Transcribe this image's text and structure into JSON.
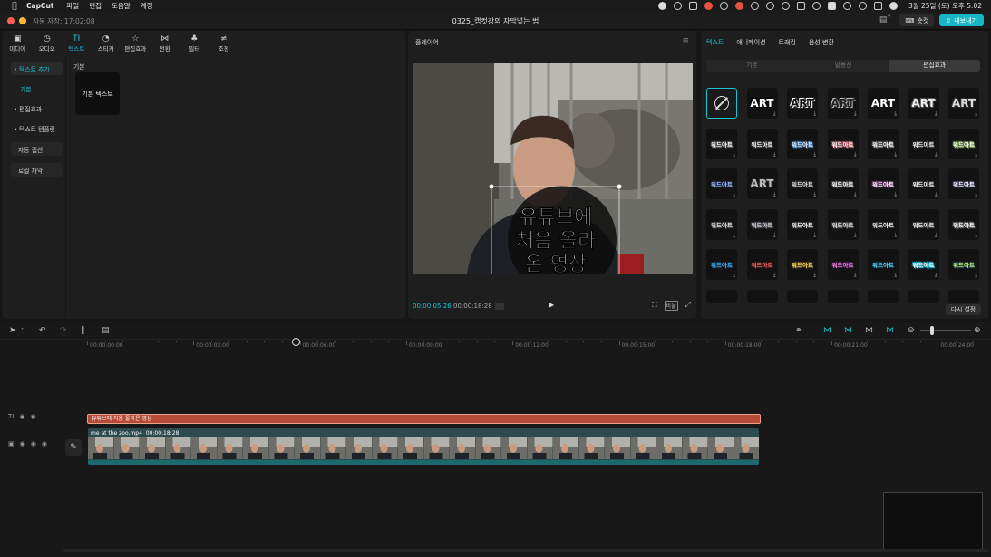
{
  "menubar": {
    "app": "CapCut",
    "menus": [
      "파일",
      "편집",
      "도움말",
      "계정"
    ],
    "clock": "3월 25일 (토) 오후 5:02"
  },
  "titlebar": {
    "autosave": "자동 저장: 17:02:08",
    "title": "0325_캡컷강의 자막넣는 법",
    "shortcut": "숏컷",
    "export": "내보내기"
  },
  "tools": [
    {
      "label": "미디어",
      "icon": "media-icon"
    },
    {
      "label": "오디오",
      "icon": "audio-icon"
    },
    {
      "label": "텍스트",
      "icon": "text-icon",
      "active": true
    },
    {
      "label": "스티커",
      "icon": "sticker-icon"
    },
    {
      "label": "편집효과",
      "icon": "effects-icon"
    },
    {
      "label": "전환",
      "icon": "transition-icon"
    },
    {
      "label": "필터",
      "icon": "filter-icon"
    },
    {
      "label": "조정",
      "icon": "adjust-icon"
    }
  ],
  "sidebar": {
    "add_text": "• 텍스트 추가",
    "basic": "기본",
    "effects": "• 편집효과",
    "templates": "• 텍스트 템플릿",
    "auto_caption": "자동 캡션",
    "local_caption": "로컬 자막"
  },
  "content": {
    "section": "기본",
    "card_label": "기본 텍스트"
  },
  "player": {
    "title": "플레이어",
    "current_time": "00:00:05:26",
    "total_time": "00:00:18:28",
    "caption_lines": [
      "유튜브에",
      "처음 올라",
      "온 영상"
    ],
    "ratio_label": "비율"
  },
  "right_panel": {
    "tabs": [
      "텍스트",
      "애니메이션",
      "트래킹",
      "음성 변환"
    ],
    "segments": [
      "기본",
      "말풍선",
      "편집효과"
    ],
    "reset": "다시 설정",
    "art_label": "ART",
    "word_label": "워드아트"
  },
  "timeline": {
    "ticks": [
      "00:00:00:00",
      "00:00:03:00",
      "00:00:06:00",
      "00:00:09:00",
      "00:00:12:00",
      "00:00:15:00",
      "00:00:18:00",
      "00:00:21:00",
      "00:00:24:00"
    ],
    "text_clip": "유튜브에 처음 올라온 영상",
    "video_clip_name": "me at the zoo.mp4",
    "video_clip_duration": "00:00:18:28"
  },
  "colors": {
    "accent": "#18c3d2",
    "text_clip": "#b34b37",
    "video_clip": "#2d4a4c"
  }
}
